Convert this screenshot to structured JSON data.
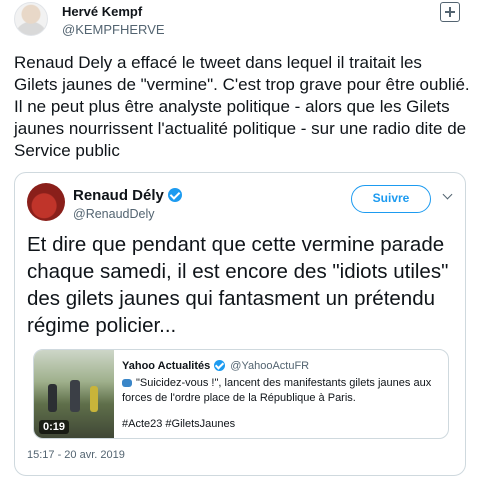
{
  "tweet": {
    "author_name": "Hervé Kempf",
    "author_handle": "@KEMPFHERVE",
    "text": "Renaud Dely a effacé le tweet dans lequel il traitait les Gilets jaunes de \"vermine\". C'est trop grave pour être oublié. Il ne peut plus être analyste politique - alors que les Gilets jaunes nourrissent l'actualité politique - sur une radio dite de Service public"
  },
  "quoted": {
    "author_name": "Renaud Dély",
    "author_handle": "@RenaudDely",
    "follow_label": "Suivre",
    "text": "Et dire que pendant que cette vermine parade chaque samedi, il est encore des \"idiots utiles\" des gilets jaunes qui fantasment un prétendu régime policier...",
    "date": "15:17 - 20 avr. 2019",
    "card": {
      "source_name": "Yahoo Actualités",
      "source_handle": "@YahooActuFR",
      "text": "\"Suicidez-vous !\", lancent des manifestants gilets jaunes aux forces de l'ordre place de la République à Paris.",
      "tags": "#Acte23 #GiletsJaunes",
      "video_duration": "0:19"
    }
  },
  "icons": {
    "verified": "verified-badge-icon",
    "more": "chevron-down-icon",
    "add": "add-content-icon",
    "speech": "speech-bubble-icon"
  },
  "colors": {
    "accent": "#1d9bf0",
    "text": "#0f1419",
    "muted": "#536471",
    "border": "#cfd9de"
  }
}
